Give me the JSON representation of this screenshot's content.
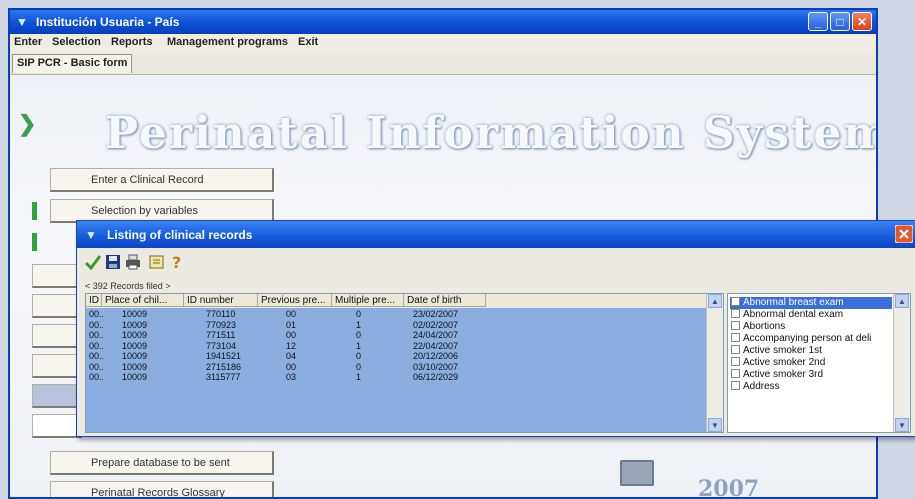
{
  "window": {
    "title": "Institución Usuaria - País",
    "controls": {
      "minimize": "_",
      "maximize": "□",
      "close": "✕"
    }
  },
  "menu": [
    "Enter",
    "Selection",
    "Reports",
    "Management programs",
    "Exit"
  ],
  "tab": {
    "label": "SIP PCR - Basic form"
  },
  "banner": {
    "title": "Perinatal Information System",
    "year": "2007"
  },
  "nav": {
    "enter_record": "Enter a Clinical Record",
    "selection_by_variables": "Selection by variables",
    "prepare_database": "Prepare database to be sent",
    "glossary": "Perinatal Records Glossary"
  },
  "dialog": {
    "title": "Listing of clinical records",
    "toolbar_icons": [
      "check-icon",
      "save-icon",
      "print-icon",
      "export-icon",
      "help-icon"
    ],
    "records_info": "< 392 Records filed >",
    "columns": [
      "ID",
      "Place of chil...",
      "ID number",
      "Previous pre...",
      "Multiple pre...",
      "Date of birth"
    ],
    "rows": [
      [
        "00...",
        "10009",
        "770110",
        "00",
        "0",
        "23/02/2007"
      ],
      [
        "00...",
        "10009",
        "770923",
        "01",
        "1",
        "02/02/2007"
      ],
      [
        "00...",
        "10009",
        "771511",
        "00",
        "0",
        "24/04/2007"
      ],
      [
        "00...",
        "10009",
        "773104",
        "12",
        "1",
        "22/04/2007"
      ],
      [
        "00...",
        "10009",
        "1941521",
        "04",
        "0",
        "20/12/2006"
      ],
      [
        "00...",
        "10009",
        "2715186",
        "00",
        "0",
        "03/10/2007"
      ],
      [
        "00...",
        "10009",
        "3115777",
        "03",
        "1",
        "06/12/2029"
      ]
    ],
    "variables": [
      "Abnormal breast exam",
      "Abnormal dental exam",
      "Abortions",
      "Accompanying person at deli",
      "Active smoker 1st",
      "Active smoker 2nd",
      "Active smoker 3rd",
      "Address"
    ],
    "selected_variable": "Abnormal breast exam"
  },
  "colors": {
    "titlebar": "#0a4ed6",
    "grid_selection": "#8aaee0",
    "nav_green": "#2fa33f"
  }
}
